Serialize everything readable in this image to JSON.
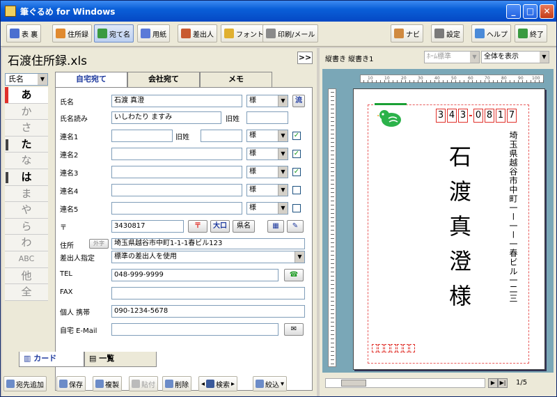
{
  "window": {
    "title": "筆ぐるめ for Windows"
  },
  "toolbar": {
    "items": [
      {
        "label": "表 裏"
      },
      {
        "label": "住所録"
      },
      {
        "label": "宛て名"
      },
      {
        "label": "用紙"
      },
      {
        "label": "差出人"
      },
      {
        "label": "フォント"
      },
      {
        "label": "印刷/メール"
      }
    ],
    "right": [
      {
        "label": "ナビ"
      },
      {
        "label": "設定"
      },
      {
        "label": "ヘルプ"
      },
      {
        "label": "終了"
      }
    ]
  },
  "left": {
    "file_name": "石渡住所録.xls",
    "nav_label": ">>",
    "sort_field": "氏名",
    "kana": [
      "あ",
      "か",
      "さ",
      "た",
      "な",
      "は",
      "ま",
      "や",
      "ら",
      "わ",
      "ABC",
      "他",
      "全"
    ],
    "tabs": [
      "自宅宛て",
      "会社宛て",
      "メモ"
    ],
    "form": {
      "name_label": "氏名",
      "name_value": "石渡 真澄",
      "honorific": "様",
      "reading_label": "氏名読み",
      "reading_value": "いしわたり ますみ",
      "old_surname_label": "旧姓",
      "joint1_label": "連名1",
      "joint_old_label": "旧姓",
      "joint2_label": "連名2",
      "joint3_label": "連名3",
      "joint4_label": "連名4",
      "joint5_label": "連名5",
      "zip_label": "〒",
      "zip_value": "3430817",
      "zip_btn_large": "大口",
      "zip_btn_name": "県名",
      "address_label": "住所",
      "address_btn": "外字",
      "address_value": "埼玉県越谷市中町1-1-1春ビル123",
      "sender_label": "差出人指定",
      "sender_value": "標準の差出人を使用",
      "tel_label": "TEL",
      "tel_value": "048-999-9999",
      "fax_label": "FAX",
      "mobile_label": "個人 携帯",
      "mobile_value": "090-1234-5678",
      "email_label": "自宅 E-Mail"
    },
    "bottom_tabs": [
      "カード",
      "一覧"
    ],
    "actions": [
      "宛先追加",
      "保存",
      "複製",
      "貼付",
      "削除",
      "検索",
      "絞込"
    ]
  },
  "right": {
    "view_label": "縦書き 縦書き1",
    "combo1": "ﾎｰﾑ標準",
    "combo2": "全体を表示",
    "ruler_marks": [
      "10",
      "10",
      "20",
      "30",
      "40",
      "50",
      "60",
      "70",
      "80",
      "90",
      "100"
    ],
    "zip_digits": [
      "3",
      "4",
      "3",
      "0",
      "8",
      "1",
      "7"
    ],
    "recipient_address": "埼玉県越谷市中町一ー一ー一春ビル一二三",
    "recipient_name": "石渡真澄様",
    "page": "1/5"
  }
}
